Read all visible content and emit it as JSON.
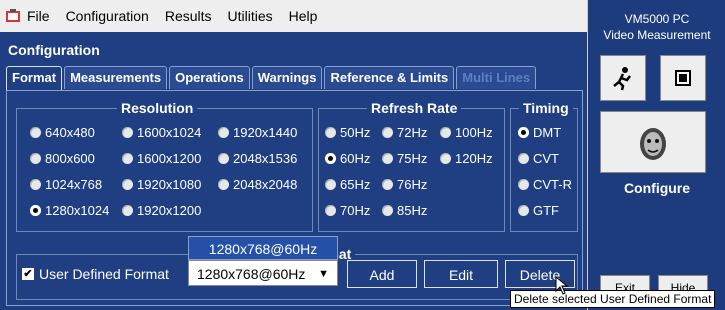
{
  "menu": [
    "File",
    "Configuration",
    "Results",
    "Utilities",
    "Help"
  ],
  "title": "Configuration",
  "tabs": [
    {
      "label": "Format",
      "state": "active"
    },
    {
      "label": "Measurements",
      "state": "normal"
    },
    {
      "label": "Operations",
      "state": "normal"
    },
    {
      "label": "Warnings",
      "state": "normal"
    },
    {
      "label": "Reference & Limits",
      "state": "normal"
    },
    {
      "label": "Multi Lines",
      "state": "disabled"
    }
  ],
  "resolution": {
    "legend": "Resolution",
    "options": [
      [
        "640x480",
        "1600x1024",
        "1920x1440"
      ],
      [
        "800x600",
        "1600x1200",
        "2048x1536"
      ],
      [
        "1024x768",
        "1920x1080",
        "2048x2048"
      ],
      [
        "1280x1024",
        "1920x1200"
      ]
    ],
    "selected": "1280x1024"
  },
  "refresh": {
    "legend": "Refresh Rate",
    "options": [
      [
        "50Hz",
        "72Hz",
        "100Hz"
      ],
      [
        "60Hz",
        "75Hz",
        "120Hz"
      ],
      [
        "65Hz",
        "76Hz"
      ],
      [
        "70Hz",
        "85Hz"
      ]
    ],
    "selected": "60Hz"
  },
  "timing": {
    "legend": "Timing",
    "options": [
      "DMT",
      "CVT",
      "CVT-R",
      "GTF"
    ],
    "selected": "DMT"
  },
  "format_group": {
    "legend_partial": "rmat"
  },
  "user_defined": {
    "label": "User Defined Format",
    "checked": true
  },
  "combo": {
    "value": "1280x768@60Hz",
    "popup": "1280x768@60Hz"
  },
  "buttons": {
    "add": "Add",
    "edit": "Edit",
    "delete": "Delete"
  },
  "tooltip": "Delete selected User Defined Format",
  "sidebar": {
    "title_line1": "VM5000 PC",
    "title_line2": "Video Measurement",
    "configure": "Configure",
    "bottom_left": "Exit",
    "bottom_right": "Hide"
  }
}
